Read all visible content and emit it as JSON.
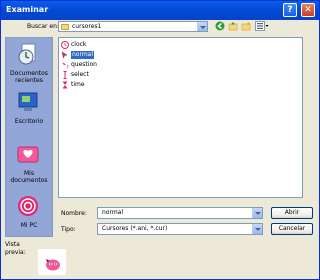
{
  "window": {
    "title": "Examinar",
    "help_glyph": "?",
    "close_glyph": "✕"
  },
  "lookin": {
    "label": "Buscar en:",
    "value": "cursores1"
  },
  "places": [
    {
      "label": "Documentos recientes",
      "icon": "recent-documents-icon"
    },
    {
      "label": "Escritorio",
      "icon": "desktop-icon"
    },
    {
      "label": "Mis documentos",
      "icon": "my-documents-icon"
    },
    {
      "label": "Mi PC",
      "icon": "my-computer-icon"
    }
  ],
  "files": [
    {
      "name": "clock",
      "selected": false
    },
    {
      "name": "normal",
      "selected": true
    },
    {
      "name": "question",
      "selected": false
    },
    {
      "name": "select",
      "selected": false
    },
    {
      "name": "time",
      "selected": false
    }
  ],
  "filename": {
    "label": "Nombre:",
    "value": "normal"
  },
  "filetype": {
    "label": "Tipo:",
    "value": "Cursores (*.ani, *.cur)"
  },
  "buttons": {
    "open": "Abrir",
    "cancel": "Cancelar"
  },
  "preview": {
    "label": "Vista previa:"
  },
  "colors": {
    "title_bar": "#0548d2",
    "selection": "#316ac5",
    "cursor_pink": "#e0286f"
  }
}
